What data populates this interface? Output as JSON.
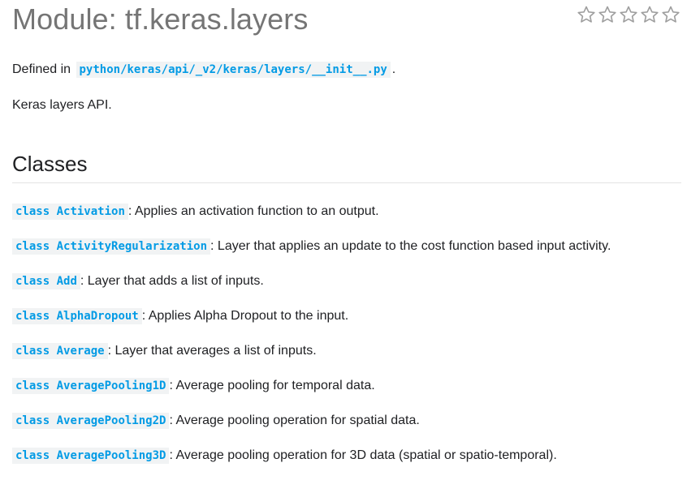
{
  "header": {
    "title": "Module: tf.keras.layers",
    "rating": {
      "max": 5,
      "value": 0,
      "icon": "star-outline-icon",
      "color": "#9e9e9e"
    }
  },
  "defined_in": {
    "prefix": "Defined in",
    "path": "python/keras/api/_v2/keras/layers/__init__.py",
    "suffix": "."
  },
  "description": "Keras layers API.",
  "classes_section": {
    "heading": "Classes",
    "keyword": "class",
    "items": [
      {
        "name": "Activation",
        "desc": ": Applies an activation function to an output."
      },
      {
        "name": "ActivityRegularization",
        "desc": ": Layer that applies an update to the cost function based input activity."
      },
      {
        "name": "Add",
        "desc": ": Layer that adds a list of inputs."
      },
      {
        "name": "AlphaDropout",
        "desc": ": Applies Alpha Dropout to the input."
      },
      {
        "name": "Average",
        "desc": ": Layer that averages a list of inputs."
      },
      {
        "name": "AveragePooling1D",
        "desc": ": Average pooling for temporal data."
      },
      {
        "name": "AveragePooling2D",
        "desc": ": Average pooling operation for spatial data."
      },
      {
        "name": "AveragePooling3D",
        "desc": ": Average pooling operation for 3D data (spatial or spatio-temporal)."
      }
    ]
  },
  "colors": {
    "link": "#039be5",
    "code_bg": "#f1f3f4",
    "title": "#757575"
  }
}
